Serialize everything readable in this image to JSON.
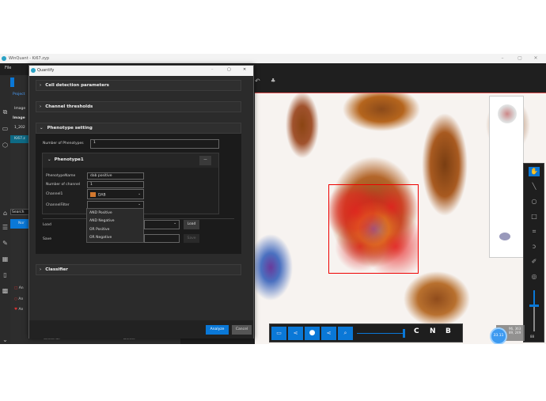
{
  "app": {
    "title": "WinQuant - Ki67.zyp",
    "menu": [
      "File"
    ],
    "window_controls": [
      "–",
      "▢",
      "✕"
    ]
  },
  "left_panel": {
    "project_tab": "Project",
    "tree_header": "Image",
    "tree_group": "Image",
    "items": [
      "1_202",
      "Ki67.z"
    ],
    "search_placeholder": "Search",
    "selected_row": "Nor",
    "annotations": [
      "An",
      "An",
      "An"
    ],
    "select_all": "Select all",
    "delete": "Delete"
  },
  "dialog": {
    "title": "Quantify",
    "window_controls": [
      "–",
      "▢",
      "✕"
    ],
    "sections": {
      "cell_detection": "Cell detection parameters",
      "channel_thresholds": "Channel thresholds",
      "phenotype_setting": "Phenotype setting",
      "classifier": "Classifier"
    },
    "phenotype": {
      "number_label": "Number of Phenotypes",
      "number_value": "1",
      "block_title": "Phenotype1",
      "remove_btn": "—",
      "name_label": "PhenotypeName",
      "name_value": "dab positive",
      "nchan_label": "Number of channel",
      "nchan_value": "1",
      "channel1_label": "Channel1",
      "channel1_value": "DAB",
      "channel1_color": "#d2782e",
      "filter_label": "ChannelFilter",
      "filter_value": "",
      "filter_options": [
        "AND Positive",
        "AND Negative",
        "OR Positive",
        "OR Negative"
      ],
      "load_label": "Load",
      "load_btn": "Load",
      "save_label": "Save",
      "save_btn": "Save"
    },
    "analyze": "Analyze",
    "cancel": "Cancel"
  },
  "viewer": {
    "bottom_letters": [
      "C",
      "N",
      "B"
    ],
    "zoom_value": "33.11",
    "coords": [
      "96, 363",
      "89, 249"
    ],
    "slider_value": "88",
    "accent": "#0a78d7"
  }
}
